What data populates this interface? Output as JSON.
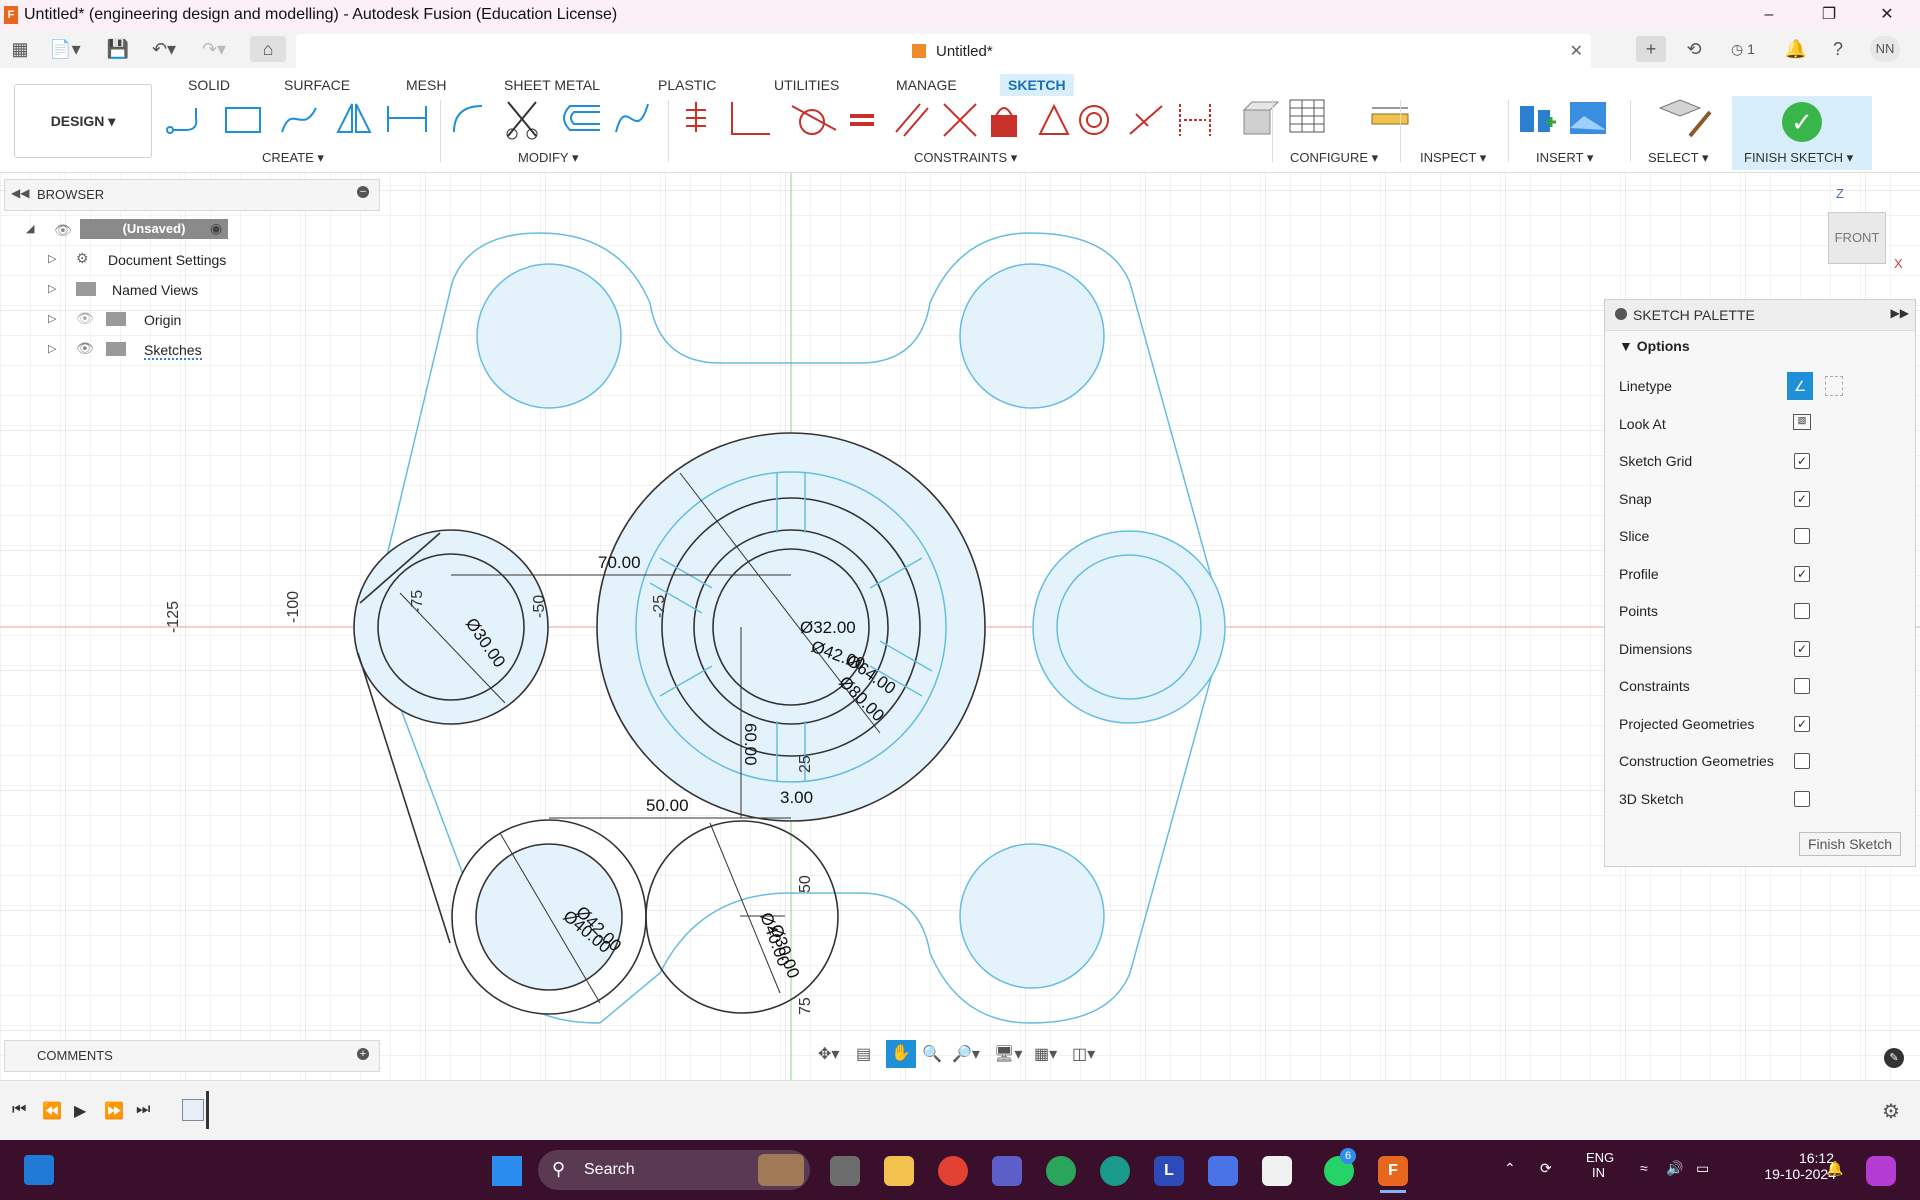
{
  "window": {
    "title": "Untitled* (engineering design and modelling) - Autodesk Fusion (Education License)",
    "app_icon": "F",
    "controls": [
      "minimize-icon",
      "restore-icon",
      "close-icon"
    ]
  },
  "quick_access": {
    "icons": [
      "apps-grid-icon",
      "file-icon",
      "save-icon",
      "undo-icon",
      "redo-icon",
      "home-icon"
    ],
    "document_tab": "Untitled*",
    "right_icons": [
      "add-tab-icon",
      "extensions-icon",
      "job-status-icon",
      "notifications-icon",
      "help-icon"
    ],
    "job_count": "1",
    "user_initials": "NN"
  },
  "ribbon": {
    "workspace": "DESIGN",
    "tabs": [
      "SOLID",
      "SURFACE",
      "MESH",
      "SHEET METAL",
      "PLASTIC",
      "UTILITIES",
      "MANAGE",
      "SKETCH"
    ],
    "active_tab": "SKETCH",
    "groups": [
      "CREATE",
      "MODIFY",
      "CONSTRAINTS",
      "CONFIGURE",
      "INSPECT",
      "INSERT",
      "SELECT",
      "FINISH SKETCH"
    ]
  },
  "browser": {
    "title": "BROWSER",
    "items": [
      {
        "label": "(Unsaved)",
        "icon": "component-icon"
      },
      {
        "label": "Document Settings",
        "icon": "gear-icon"
      },
      {
        "label": "Named Views",
        "icon": "folder-icon"
      },
      {
        "label": "Origin",
        "icon": "folder-icon"
      },
      {
        "label": "Sketches",
        "icon": "folder-icon"
      }
    ]
  },
  "comments": {
    "title": "COMMENTS"
  },
  "viewcube": {
    "face": "FRONT",
    "axis_z": "Z",
    "axis_x": "X"
  },
  "palette": {
    "title": "SKETCH PALETTE",
    "section": "Options",
    "options": [
      {
        "label": "Linetype",
        "type": "icons"
      },
      {
        "label": "Look At",
        "type": "icon"
      },
      {
        "label": "Sketch Grid",
        "checked": true
      },
      {
        "label": "Snap",
        "checked": true
      },
      {
        "label": "Slice",
        "checked": false
      },
      {
        "label": "Profile",
        "checked": true
      },
      {
        "label": "Points",
        "checked": false
      },
      {
        "label": "Dimensions",
        "checked": true
      },
      {
        "label": "Constraints",
        "checked": false
      },
      {
        "label": "Projected Geometries",
        "checked": true
      },
      {
        "label": "Construction Geometries",
        "checked": false
      },
      {
        "label": "3D Sketch",
        "checked": false
      }
    ],
    "finish_button": "Finish Sketch"
  },
  "sketch": {
    "dimensions": [
      "70.00",
      "Ø32.00",
      "Ø42.00",
      "Ø64.00",
      "Ø80.00",
      "50.00",
      "3.00",
      "60.00",
      "Ø30.00",
      "Ø42.00",
      "Ø40.00",
      "Ø30.00",
      "Ø40.00"
    ],
    "grid_labels": [
      "-125",
      "-100",
      "-75",
      "-50",
      "-25",
      "25",
      "50",
      "75"
    ]
  },
  "taskbar": {
    "search_placeholder": "Search",
    "language": "ENG",
    "region": "IN",
    "time": "16:12",
    "date": "19-10-2024",
    "whatsapp_badge": "6"
  }
}
